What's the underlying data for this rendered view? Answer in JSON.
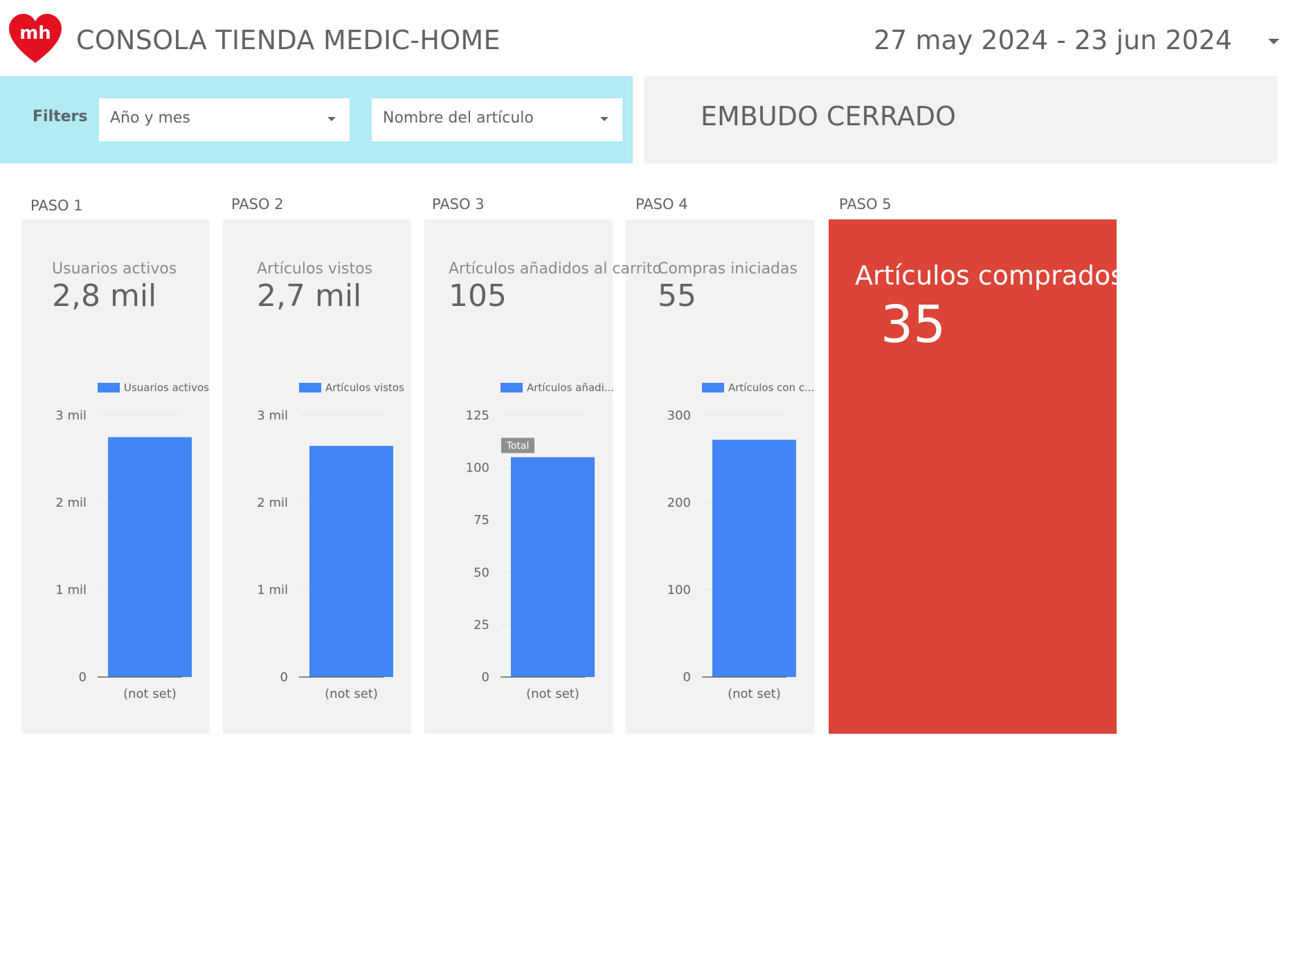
{
  "header": {
    "logo_text": "mh",
    "title": "CONSOLA TIENDA MEDIC-HOME",
    "date_range": "27 may 2024 - 23 jun 2024"
  },
  "filters": {
    "label": "Filters",
    "dropdowns": [
      "Año y mes",
      "Nombre del artículo"
    ]
  },
  "funnel": {
    "title": "EMBUDO CERRADO"
  },
  "colors": {
    "filter_bg": "#b2ebf2",
    "card_bg": "#f2f2f2",
    "bar": "#4285f4",
    "highlight": "#db4437"
  },
  "steps": [
    {
      "label": "PASO 1",
      "kpi_label": "Usuarios activos",
      "kpi_value": "2,8 mil"
    },
    {
      "label": "PASO 2",
      "kpi_label": "Artículos vistos",
      "kpi_value": "2,7 mil"
    },
    {
      "label": "PASO 3",
      "kpi_label": "Artículos añadidos al carrito",
      "kpi_value": "105"
    },
    {
      "label": "PASO 4",
      "kpi_label": "Compras iniciadas",
      "kpi_value": "55"
    },
    {
      "label": "PASO 5",
      "kpi_label": "Artículos comprados",
      "kpi_value": "35"
    }
  ],
  "chart_data": [
    {
      "type": "bar",
      "legend": "Usuarios activos",
      "categories": [
        "(not set)"
      ],
      "values": [
        2750
      ],
      "ylim": [
        0,
        3000
      ],
      "ticks": [
        0,
        1000,
        2000,
        3000
      ],
      "tick_labels": [
        "0",
        "1 mil",
        "2 mil",
        "3 mil"
      ],
      "grid": true,
      "legend_position": "top"
    },
    {
      "type": "bar",
      "legend": "Artículos vistos",
      "categories": [
        "(not set)"
      ],
      "values": [
        2650
      ],
      "ylim": [
        0,
        3000
      ],
      "ticks": [
        0,
        1000,
        2000,
        3000
      ],
      "tick_labels": [
        "0",
        "1 mil",
        "2 mil",
        "3 mil"
      ],
      "grid": true,
      "legend_position": "top"
    },
    {
      "type": "bar",
      "legend": "Artículos añadi...",
      "categories": [
        "(not set)"
      ],
      "values": [
        105
      ],
      "ylim": [
        0,
        125
      ],
      "ticks": [
        0,
        25,
        50,
        75,
        100,
        125
      ],
      "tick_labels": [
        "0",
        "25",
        "50",
        "75",
        "100",
        "125"
      ],
      "grid": true,
      "legend_position": "top",
      "annotation": "Total"
    },
    {
      "type": "bar",
      "legend": "Artículos con c...",
      "categories": [
        "(not set)"
      ],
      "values": [
        272
      ],
      "ylim": [
        0,
        300
      ],
      "ticks": [
        0,
        100,
        200,
        300
      ],
      "tick_labels": [
        "0",
        "100",
        "200",
        "300"
      ],
      "grid": true,
      "legend_position": "top"
    }
  ]
}
